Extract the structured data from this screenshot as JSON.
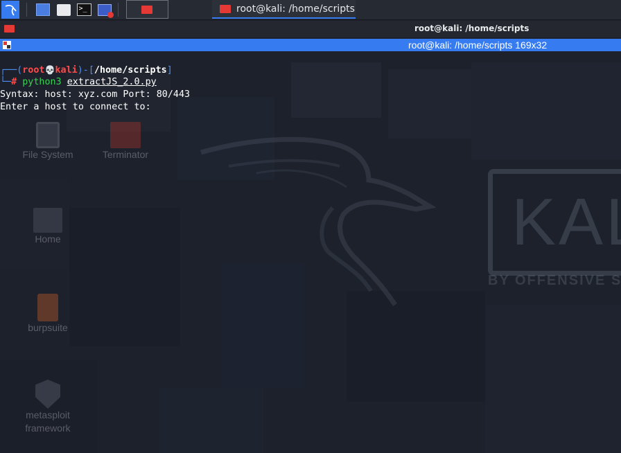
{
  "panel": {
    "window_task_label": "root@kali: /home/scripts"
  },
  "window": {
    "title": "root@kali: /home/scripts",
    "tab_title": "root@kali: /home/scripts 169x32"
  },
  "terminal": {
    "prompt": {
      "prefix_top": "┌──(",
      "user": "root",
      "skull": "💀",
      "host": "kali",
      "mid": ")-[",
      "path": "/home/scripts",
      "close": "]",
      "prefix_bottom": "└─",
      "hash": "# ",
      "command": "python3",
      "space": " ",
      "argument": "extractJS_2.0.py"
    },
    "output": [
      "Syntax: host: xyz.com Port: 80/443",
      "Enter a host to connect to:"
    ]
  },
  "desktop": {
    "icons": [
      {
        "label": "File System"
      },
      {
        "label": "Terminator"
      },
      {
        "label": "Home"
      },
      {
        "label": "burpsuite"
      },
      {
        "label": "metasploit"
      },
      {
        "label": "framework"
      }
    ],
    "wallpaper_logo_text": "KAL",
    "wallpaper_sub_text": "BY OFFENSIVE SE"
  },
  "colors": {
    "panel_bg": "#252a33",
    "tab_accent": "#367bf0",
    "prompt_blue": "#4d8ff0",
    "prompt_red": "#ff4a4a",
    "command_green": "#39d353"
  }
}
